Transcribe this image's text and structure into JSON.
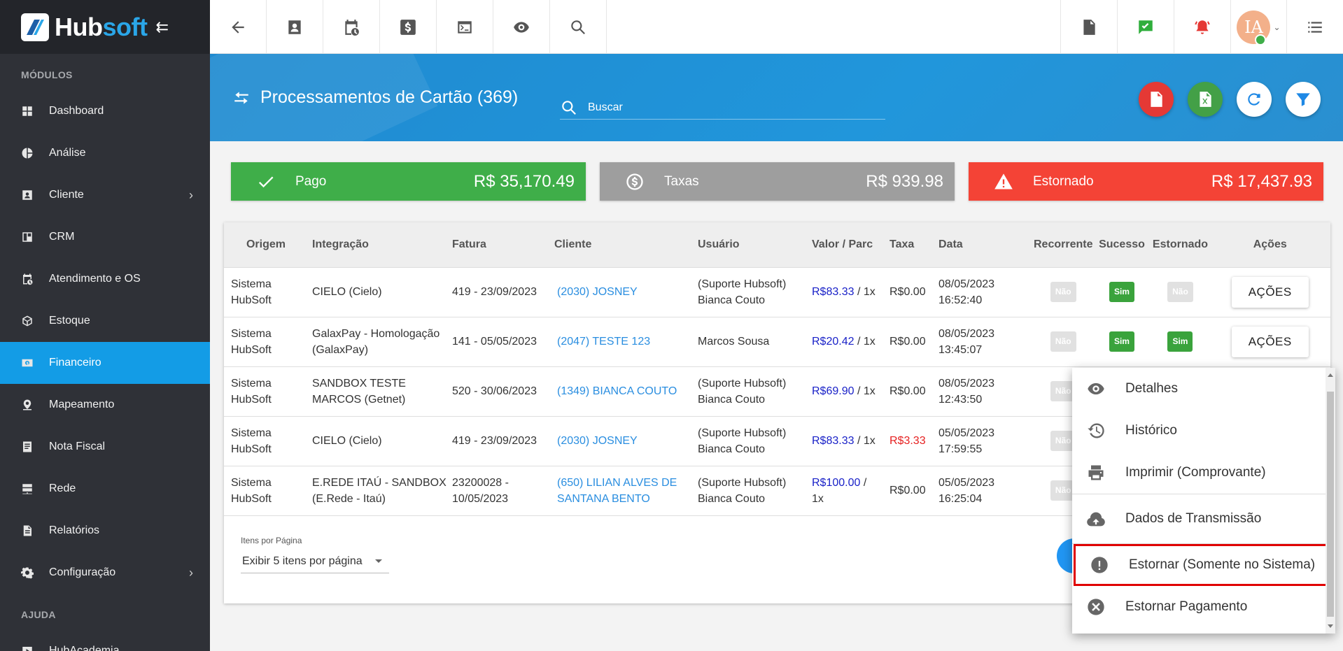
{
  "brand": {
    "hub": "Hub",
    "soft": "soft",
    "collapse_icon": "⇇"
  },
  "sidebar": {
    "section_modules": "MÓDULOS",
    "section_help": "AJUDA",
    "items": [
      {
        "label": "Dashboard",
        "icon": "dashboard-icon"
      },
      {
        "label": "Análise",
        "icon": "pie-chart-icon"
      },
      {
        "label": "Cliente",
        "icon": "contact-card-icon",
        "chevron": "›"
      },
      {
        "label": "CRM",
        "icon": "crm-board-icon"
      },
      {
        "label": "Atendimento e OS",
        "icon": "calendar-clock-icon"
      },
      {
        "label": "Estoque",
        "icon": "box-icon"
      },
      {
        "label": "Financeiro",
        "icon": "money-icon"
      },
      {
        "label": "Mapeamento",
        "icon": "map-pin-icon"
      },
      {
        "label": "Nota Fiscal",
        "icon": "invoice-icon"
      },
      {
        "label": "Rede",
        "icon": "server-icon"
      },
      {
        "label": "Relatórios",
        "icon": "report-icon"
      },
      {
        "label": "Configuração",
        "icon": "gear-icon",
        "chevron": "›"
      }
    ],
    "help_items": [
      {
        "label": "HubAcademia",
        "icon": "play-icon"
      }
    ]
  },
  "header": {
    "title": "Processamentos de Cartão (369)",
    "search_placeholder": "Buscar"
  },
  "cards": [
    {
      "label": "Pago",
      "value": "R$ 35,170.49",
      "color": "#3fae49"
    },
    {
      "label": "Taxas",
      "value": "R$ 939.98",
      "color": "#9e9e9e"
    },
    {
      "label": "Estornado",
      "value": "R$ 17,437.93",
      "color": "#f44336"
    }
  ],
  "table": {
    "columns": [
      "Origem",
      "Integração",
      "Fatura",
      "Cliente",
      "Usuário",
      "Valor / Parc",
      "Taxa",
      "Data",
      "Recorrente",
      "Sucesso",
      "Estornado",
      "Ações"
    ],
    "rows": [
      {
        "origem1": "Sistema",
        "origem2": "HubSoft",
        "int1": "CIELO (Cielo)",
        "int2": "",
        "fat1": "419 - 23/09/2023",
        "fat2": "",
        "cli1": "(2030) JOSNEY",
        "cli2": "",
        "usr1": "(Suporte Hubsoft)",
        "usr2": "Bianca Couto",
        "valor": "R$83.33",
        "parc": " / 1x",
        "parc2": "",
        "taxa": "R$0.00",
        "taxa_red": false,
        "data1": "08/05/2023",
        "data2": "16:52:40",
        "rec": "Não",
        "suc": "Sim",
        "est": "Não",
        "est_yes": false,
        "acao": "AÇÕES"
      },
      {
        "origem1": "Sistema",
        "origem2": "HubSoft",
        "int1": "GalaxPay - Homologação",
        "int2": "(GalaxPay)",
        "fat1": "141 - 05/05/2023",
        "fat2": "",
        "cli1": "(2047) TESTE 123",
        "cli2": "",
        "usr1": "Marcos Sousa",
        "usr2": "",
        "valor": "R$20.42",
        "parc": " / 1x",
        "parc2": "",
        "taxa": "R$0.00",
        "taxa_red": false,
        "data1": "08/05/2023",
        "data2": "13:45:07",
        "rec": "Não",
        "suc": "Sim",
        "est": "Sim",
        "est_yes": true,
        "acao": "AÇÕES"
      },
      {
        "origem1": "Sistema",
        "origem2": "HubSoft",
        "int1": "SANDBOX TESTE",
        "int2": "MARCOS (Getnet)",
        "fat1": "520 - 30/06/2023",
        "fat2": "",
        "cli1": "(1349) BIANCA COUTO",
        "cli2": "",
        "usr1": "(Suporte Hubsoft)",
        "usr2": "Bianca Couto",
        "valor": "R$69.90",
        "parc": " / 1x",
        "parc2": "",
        "taxa": "R$0.00",
        "taxa_red": false,
        "data1": "08/05/2023",
        "data2": "12:43:50",
        "rec": "Não",
        "suc": "",
        "est": "",
        "est_yes": false,
        "acao": ""
      },
      {
        "origem1": "Sistema",
        "origem2": "HubSoft",
        "int1": "CIELO (Cielo)",
        "int2": "",
        "fat1": "419 - 23/09/2023",
        "fat2": "",
        "cli1": "(2030) JOSNEY",
        "cli2": "",
        "usr1": "(Suporte Hubsoft)",
        "usr2": "Bianca Couto",
        "valor": "R$83.33",
        "parc": " / 1x",
        "parc2": "",
        "taxa": "R$3.33",
        "taxa_red": true,
        "data1": "05/05/2023",
        "data2": "17:59:55",
        "rec": "Não",
        "suc": "",
        "est": "",
        "est_yes": false,
        "acao": ""
      },
      {
        "origem1": "Sistema",
        "origem2": "HubSoft",
        "int1": "E.REDE ITAÚ - SANDBOX",
        "int2": "(E.Rede - Itaú)",
        "fat1": "23200028 -",
        "fat2": "10/05/2023",
        "cli1": "(650) LILIAN ALVES DE",
        "cli2": "SANTANA BENTO",
        "usr1": "(Suporte Hubsoft)",
        "usr2": "Bianca Couto",
        "valor": "R$100.00",
        "parc": " /",
        "parc2": "1x",
        "taxa": "R$0.00",
        "taxa_red": false,
        "data1": "05/05/2023",
        "data2": "16:25:04",
        "rec": "Não",
        "suc": "",
        "est": "",
        "est_yes": false,
        "acao": ""
      }
    ]
  },
  "pager": {
    "label": "Itens por Página",
    "selected": "Exibir 5 itens por página"
  },
  "dropdown": {
    "items": [
      {
        "label": "Detalhes",
        "icon": "eye-icon"
      },
      {
        "label": "Histórico",
        "icon": "history-icon"
      },
      {
        "label": "Imprimir (Comprovante)",
        "icon": "printer-icon"
      },
      {
        "label": "Dados de Transmissão",
        "icon": "cloud-upload-icon"
      },
      {
        "label": "Estornar (Somente no Sistema)",
        "icon": "alert-circle-icon"
      },
      {
        "label": "Estornar Pagamento",
        "icon": "close-circle-icon"
      }
    ]
  },
  "avatar_initials": "IA",
  "colors": {
    "accent": "#139ce6",
    "header_blue": "#2196db",
    "link": "#2a8ee0",
    "value_blue": "#1a22c8",
    "red": "#e62121"
  }
}
